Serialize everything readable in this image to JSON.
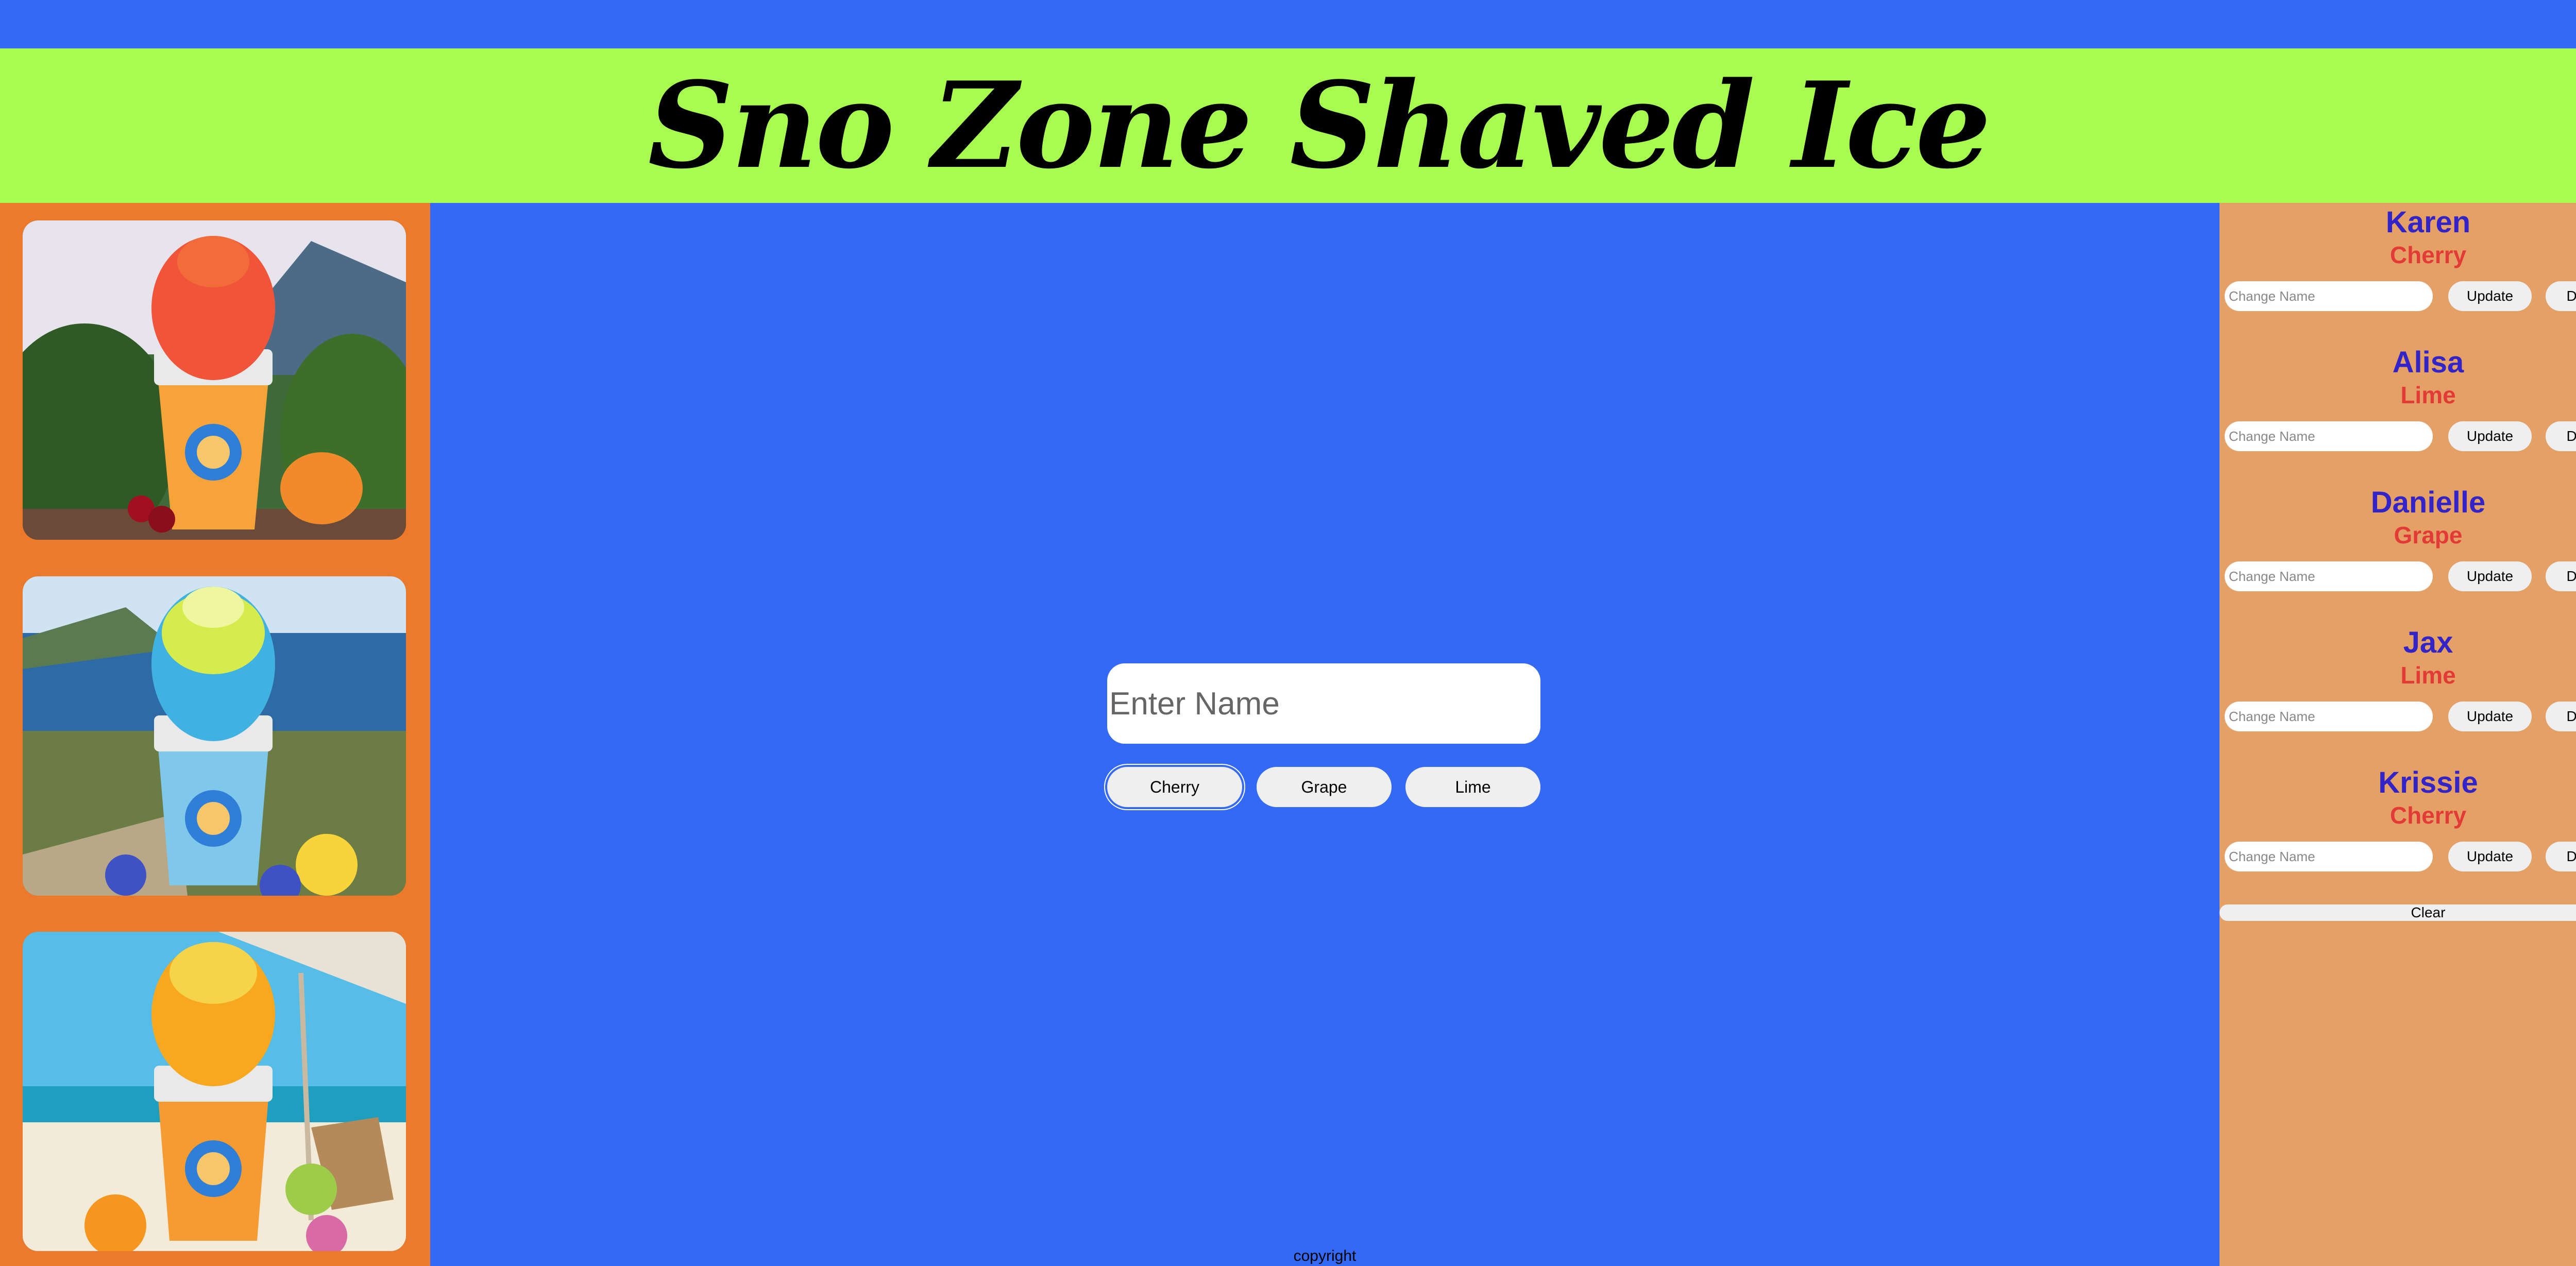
{
  "header": {
    "title": "Sno Zone Shaved Ice"
  },
  "gallery": [
    {
      "alt": "cherry-shaved-ice-photo",
      "colors": {
        "sky": "#7fa7c9",
        "ice": "#f0553a",
        "cup": "#f6a33a"
      }
    },
    {
      "alt": "lime-shaved-ice-photo",
      "colors": {
        "sky": "#8bbbe0",
        "ice": "#b5e34a",
        "cup": "#7fc8ea"
      }
    },
    {
      "alt": "orange-shaved-ice-photo",
      "colors": {
        "sky": "#56bde8",
        "ice": "#f8a81f",
        "cup": "#f69b31"
      }
    }
  ],
  "form": {
    "name_placeholder": "Enter Name",
    "flavors": [
      "Cherry",
      "Grape",
      "Lime"
    ]
  },
  "orders": [
    {
      "name": "Karen",
      "flavor": "Cherry"
    },
    {
      "name": "Alisa",
      "flavor": "Lime"
    },
    {
      "name": "Danielle",
      "flavor": "Grape"
    },
    {
      "name": "Jax",
      "flavor": "Lime"
    },
    {
      "name": "Krissie",
      "flavor": "Cherry"
    }
  ],
  "order_controls": {
    "change_placeholder": "Change Name",
    "update_label": "Update",
    "delete_label": "Delete"
  },
  "clear_label": "Clear",
  "footer": {
    "copyright": "copyright"
  },
  "colors": {
    "blue_bg": "#3369f5",
    "header_green": "#a8fc4f",
    "left_orange": "#eb7a2d",
    "right_tan": "#e5a165",
    "name_blue": "#3324c7",
    "flavor_red": "#e23a37"
  }
}
